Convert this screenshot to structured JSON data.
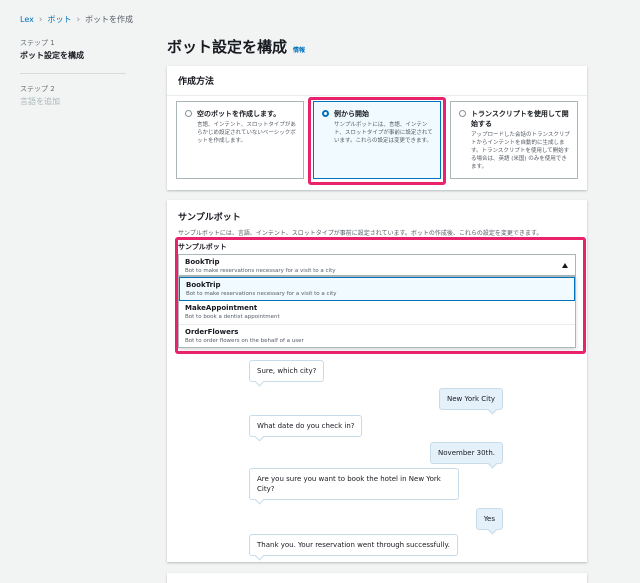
{
  "breadcrumb": {
    "items": [
      "Lex",
      "ボット",
      "ボットを作成"
    ]
  },
  "steps": [
    {
      "label": "ステップ 1",
      "title": "ボット設定を構成"
    },
    {
      "label": "ステップ 2",
      "title": "言語を追加"
    }
  ],
  "page": {
    "title": "ボット設定を構成",
    "info": "情報"
  },
  "creation": {
    "header": "作成方法",
    "options": [
      {
        "title": "空のボットを作成します。",
        "desc": "言語、インテント、スロットタイプがあらかじめ設定されていないベーシックボットを作成します。"
      },
      {
        "title": "例から開始",
        "desc": "サンプルボットには、言語、インテント、スロットタイプが事前に設定されています。これらの設定は変更できます。"
      },
      {
        "title": "トランスクリプトを使用して開始する",
        "desc": "アップロードした会話のトランスクリプトからインテントを自動的に生成します。トランスクリプトを使用して開始する場合は、英語 (米国) のみを使用できます。"
      }
    ],
    "selected_index": 1
  },
  "sample": {
    "title": "サンプルボット",
    "desc": "サンプルボットには、言語、インテント、スロットタイプが事前に設定されています。ボットの作成後、これらの設定を変更できます。",
    "field_label": "サンプルボット",
    "selected": {
      "name": "BookTrip",
      "desc": "Bot to make reservations necessary for a visit to a city"
    },
    "options": [
      {
        "name": "BookTrip",
        "desc": "Bot to make reservations necessary for a visit to a city"
      },
      {
        "name": "MakeAppointment",
        "desc": "Bot to book a dentist appointment"
      },
      {
        "name": "OrderFlowers",
        "desc": "Bot to order flowers on the behalf of a user"
      }
    ]
  },
  "chat": [
    {
      "side": "left",
      "text": "Sure, which city?"
    },
    {
      "side": "right",
      "text": "New York City"
    },
    {
      "side": "left",
      "text": "What date do you check in?"
    },
    {
      "side": "right",
      "text": "November 30th."
    },
    {
      "side": "left",
      "text": "Are you sure you want to book the hotel in New York City?"
    },
    {
      "side": "right",
      "text": "Yes"
    },
    {
      "side": "left",
      "text": "Thank you. Your reservation went through successfully."
    }
  ],
  "colors": {
    "accent": "#0073bb",
    "highlight": "#e8226b",
    "background": "#f2f3f3"
  }
}
